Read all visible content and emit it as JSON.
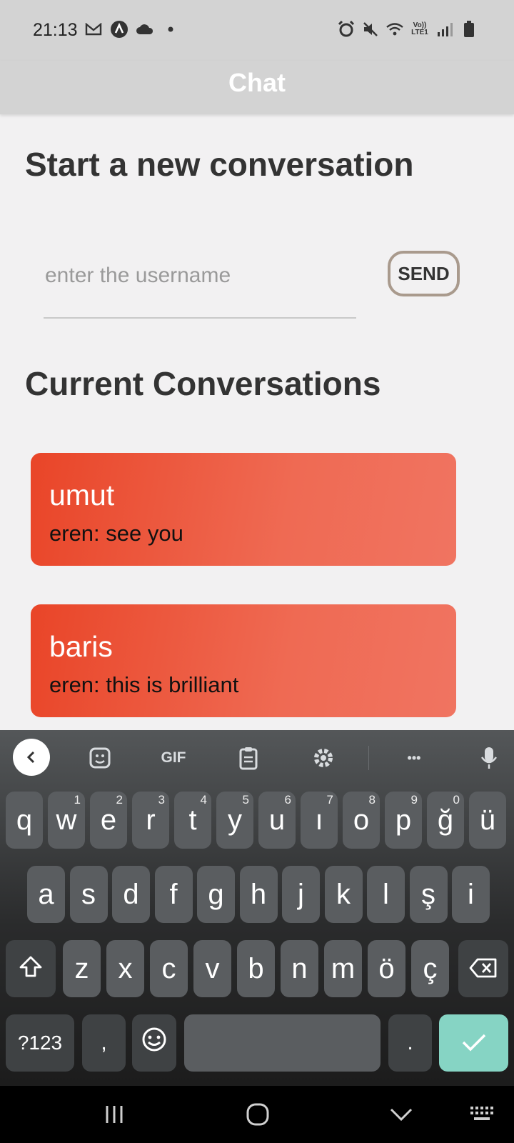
{
  "status": {
    "time": "21:13",
    "left_icons": [
      "gmail-icon",
      "app-circle-icon",
      "cloud-icon",
      "dot-icon"
    ],
    "right_icons": [
      "alarm-icon",
      "mute-icon",
      "wifi-icon",
      "volte-icon",
      "signal-icon",
      "battery-icon"
    ],
    "volte_label": "Vo)) LTE1"
  },
  "appbar": {
    "title": "Chat"
  },
  "new_conversation": {
    "heading": "Start a new conversation",
    "placeholder": "enter the username",
    "send_label": "SEND"
  },
  "current": {
    "heading": "Current Conversations",
    "conversations": [
      {
        "name": "umut",
        "preview": "eren: see you"
      },
      {
        "name": "baris",
        "preview": "eren: this is brilliant"
      }
    ]
  },
  "keyboard": {
    "toolbar": {
      "gif_label": "GIF",
      "more_label": "•••"
    },
    "row1": [
      {
        "k": "q",
        "s": ""
      },
      {
        "k": "w",
        "s": "1"
      },
      {
        "k": "e",
        "s": "2"
      },
      {
        "k": "r",
        "s": "3"
      },
      {
        "k": "t",
        "s": "4"
      },
      {
        "k": "y",
        "s": "5"
      },
      {
        "k": "u",
        "s": "6"
      },
      {
        "k": "ı",
        "s": "7"
      },
      {
        "k": "o",
        "s": "8"
      },
      {
        "k": "p",
        "s": "9"
      },
      {
        "k": "ğ",
        "s": "0"
      },
      {
        "k": "ü",
        "s": ""
      }
    ],
    "row2": [
      "a",
      "s",
      "d",
      "f",
      "g",
      "h",
      "j",
      "k",
      "l",
      "ş",
      "i"
    ],
    "row3": [
      "z",
      "x",
      "c",
      "v",
      "b",
      "n",
      "m",
      "ö",
      "ç"
    ],
    "symbols_label": "?123",
    "comma_label": ",",
    "period_label": ".",
    "accent_color": "#86d4c4"
  },
  "colors": {
    "card_start": "#e94528",
    "card_end": "#f07461",
    "appbar": "#d3d3d3",
    "background": "#f2f1f2"
  }
}
